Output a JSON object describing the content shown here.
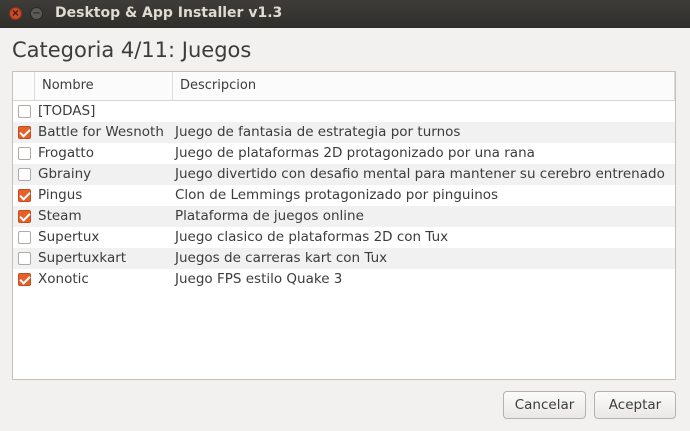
{
  "window": {
    "title": "Desktop & App Installer v1.3",
    "close_glyph": "×",
    "minimize_glyph": "−"
  },
  "heading": "Categoria 4/11: Juegos",
  "columns": {
    "check": "",
    "name": "Nombre",
    "description": "Descripcion"
  },
  "items": [
    {
      "name": "[TODAS]",
      "description": "",
      "checked": false
    },
    {
      "name": "Battle for Wesnoth",
      "description": "Juego de fantasia de estrategia por turnos",
      "checked": true
    },
    {
      "name": "Frogatto",
      "description": "Juego de plataformas 2D protagonizado por una rana",
      "checked": false
    },
    {
      "name": "Gbrainy",
      "description": "Juego divertido con desafio mental para mantener su cerebro entrenado",
      "checked": false
    },
    {
      "name": "Pingus",
      "description": "Clon de Lemmings protagonizado por pinguinos",
      "checked": true
    },
    {
      "name": "Steam",
      "description": "Plataforma de juegos online",
      "checked": true
    },
    {
      "name": "Supertux",
      "description": "Juego clasico de plataformas 2D con Tux",
      "checked": false
    },
    {
      "name": "Supertuxkart",
      "description": "Juegos de carreras kart con Tux",
      "checked": false
    },
    {
      "name": "Xonotic",
      "description": "Juego FPS estilo Quake 3",
      "checked": true
    }
  ],
  "buttons": {
    "cancel": "Cancelar",
    "accept": "Aceptar"
  },
  "colors": {
    "accent": "#e6602a",
    "titlebar": "#3c3b37"
  }
}
